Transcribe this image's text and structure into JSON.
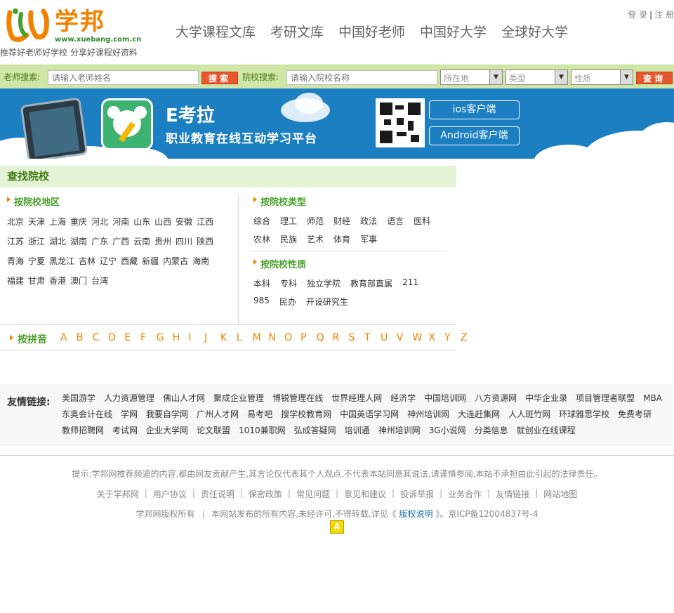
{
  "header": {
    "logo_text": "学邦",
    "logo_url": "www.xuebang.com.cn",
    "slogan": "推荐好老师好学校 分享好课程好资料",
    "nav": [
      "大学课程文库",
      "考研文库",
      "中国好老师",
      "中国好大学",
      "全球好大学"
    ],
    "login": "登 录",
    "register": "注 册"
  },
  "search": {
    "teacher_label": "老师搜索:",
    "teacher_placeholder": "请输入老师姓名",
    "teacher_btn": "搜索",
    "school_label": "院校搜索:",
    "school_placeholder": "请输入院校名称",
    "select_location": "所在地",
    "select_type": "类型",
    "select_nature": "性质",
    "school_btn": "查询"
  },
  "banner": {
    "brand": "E考拉",
    "tagline": "职业教育在线互动学习平台",
    "ios_btn": "ios客户端",
    "android_btn": "Android客户端"
  },
  "find": {
    "title": "查找院校",
    "region_title": "按院校地区",
    "regions": [
      "北京",
      "天津",
      "上海",
      "重庆",
      "河北",
      "河南",
      "山东",
      "山西",
      "安徽",
      "江西",
      "江苏",
      "浙江",
      "湖北",
      "湖南",
      "广东",
      "广西",
      "云南",
      "贵州",
      "四川",
      "陕西",
      "青海",
      "宁夏",
      "黑龙江",
      "吉林",
      "辽宁",
      "西藏",
      "新疆",
      "内蒙古",
      "海南",
      "福建",
      "甘肃",
      "香港",
      "澳门",
      "台湾"
    ],
    "type_title": "按院校类型",
    "types": [
      "综合",
      "理工",
      "师范",
      "财经",
      "政法",
      "语言",
      "医科",
      "农林",
      "民族",
      "艺术",
      "体育",
      "军事"
    ],
    "nature_title": "按院校性质",
    "natures": [
      "本科",
      "专科",
      "独立学院",
      "教育部直属",
      "211",
      "985",
      "民办",
      "开设研究生"
    ],
    "pinyin_title": "按拼音",
    "letters": [
      "A",
      "B",
      "C",
      "D",
      "E",
      "F",
      "G",
      "H",
      "I",
      "J",
      "K",
      "L",
      "M",
      "N",
      "O",
      "P",
      "Q",
      "R",
      "S",
      "T",
      "U",
      "V",
      "W",
      "X",
      "Y",
      "Z"
    ]
  },
  "friends": {
    "title": "友情链接:",
    "links": [
      "美国游学",
      "人力资源管理",
      "佛山人才网",
      "聚成企业管理",
      "博锐管理在线",
      "世界经理人网",
      "经济学",
      "中国培训网",
      "八方资源网",
      "中华企业录",
      "项目管理者联盟",
      "MBA",
      "东奥会计在线",
      "学网",
      "我要自学网",
      "广州人才网",
      "易考吧",
      "搜学校教育网",
      "中国英语学习网",
      "神州培训网",
      "大连赶集网",
      "人人斑竹网",
      "环球雅思学校",
      "免费考研",
      "教师招聘网",
      "考试网",
      "企业大学网",
      "论文联盟",
      "1010兼职网",
      "弘成答疑网",
      "培训通",
      "神州培训网",
      "3G小说网",
      "分类信息",
      "就创业在线课程"
    ]
  },
  "footer": {
    "notice": "提示:学邦网推荐频道的内容,都由网友贡献产生,其言论仅代表其个人观点,不代表本站同意其说法,请谨慎参阅,本站不承担由此引起的法律责任。",
    "links": [
      "关于学邦网",
      "用户协议",
      "责任说明",
      "保密政策",
      "常见问题",
      "意见和建议",
      "投诉举报",
      "业务合作",
      "友情链接",
      "网站地图"
    ],
    "copy_left": "学邦网版权所有",
    "copy_mid": "本网站发布的所有内容,未经许可,不得转载,详见《",
    "copy_link": "版权说明",
    "copy_right": "》。京ICP备12004837号-4",
    "badge": "A"
  }
}
